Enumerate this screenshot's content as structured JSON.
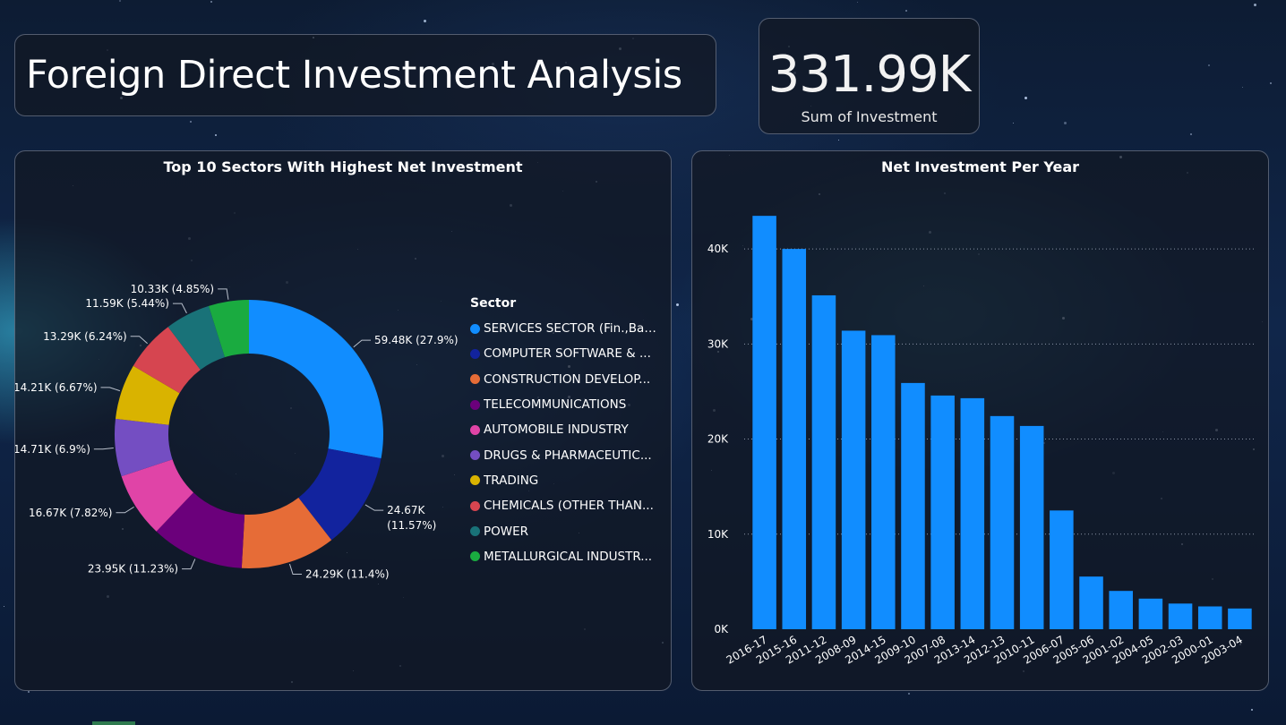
{
  "dashboard": {
    "title": "Foreign Direct Investment Analysis",
    "kpi": {
      "value": "331.99K",
      "label": "Sum of Investment"
    }
  },
  "chart_data": [
    {
      "type": "donut",
      "title": "Top 10 Sectors With Highest Net Investment",
      "legend_title": "Sector",
      "legend_position": "right",
      "slices": [
        {
          "name": "SERVICES SECTOR (Fin.,Ban...",
          "value": 59.48,
          "label": "59.48K (27.9%)",
          "color": "#118dff"
        },
        {
          "name": "COMPUTER SOFTWARE & ...",
          "value": 24.67,
          "label": "24.67K (11.57%)",
          "color": "#12239e"
        },
        {
          "name": "CONSTRUCTION DEVELOP...",
          "value": 24.29,
          "label": "24.29K (11.4%)",
          "color": "#e66c37"
        },
        {
          "name": "TELECOMMUNICATIONS",
          "value": 23.95,
          "label": "23.95K (11.23%)",
          "color": "#6b007b"
        },
        {
          "name": "AUTOMOBILE INDUSTRY",
          "value": 16.67,
          "label": "16.67K (7.82%)",
          "color": "#e044a7"
        },
        {
          "name": "DRUGS & PHARMACEUTIC...",
          "value": 14.71,
          "label": "14.71K (6.9%)",
          "color": "#744ec2"
        },
        {
          "name": "TRADING",
          "value": 14.21,
          "label": "14.21K (6.67%)",
          "color": "#d9b300"
        },
        {
          "name": "CHEMICALS (OTHER THAN...",
          "value": 13.29,
          "label": "13.29K (6.24%)",
          "color": "#d64550"
        },
        {
          "name": "POWER",
          "value": 11.59,
          "label": "11.59K (5.44%)",
          "color": "#197278"
        },
        {
          "name": "METALLURGICAL INDUSTR...",
          "value": 10.33,
          "label": "10.33K (4.85%)",
          "color": "#1aab40"
        }
      ]
    },
    {
      "type": "bar",
      "title": "Net Investment Per Year",
      "bar_color": "#118dff",
      "grid": true,
      "ylim": [
        0,
        45000
      ],
      "yticks": [
        0,
        10000,
        20000,
        30000,
        40000
      ],
      "ytick_labels": [
        "0K",
        "10K",
        "20K",
        "30K",
        "40K"
      ],
      "categories": [
        "2016-17",
        "2015-16",
        "2011-12",
        "2008-09",
        "2014-15",
        "2009-10",
        "2007-08",
        "2013-14",
        "2012-13",
        "2010-11",
        "2006-07",
        "2005-06",
        "2001-02",
        "2004-05",
        "2002-03",
        "2000-01",
        "2003-04"
      ],
      "values": [
        43480,
        40000,
        35120,
        31400,
        30930,
        25900,
        24580,
        24300,
        22420,
        21380,
        12490,
        5540,
        4030,
        3220,
        2700,
        2400,
        2180
      ]
    }
  ]
}
